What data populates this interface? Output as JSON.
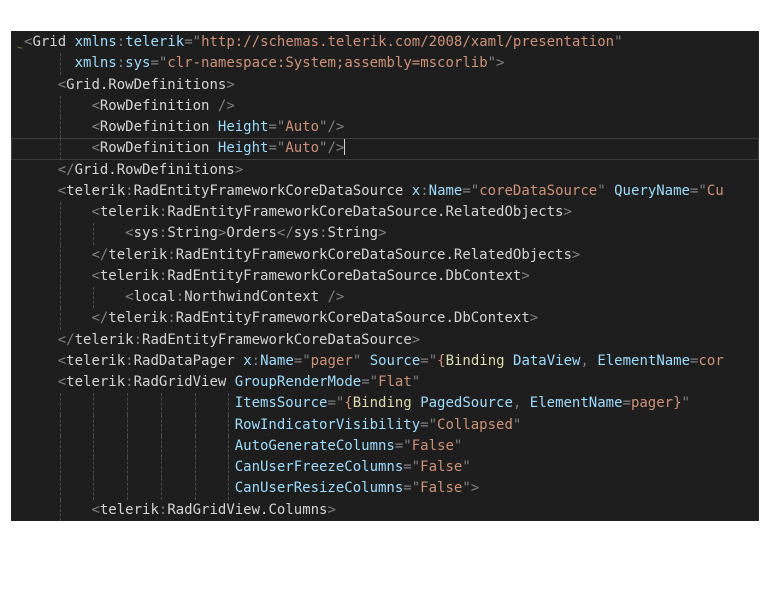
{
  "colors": {
    "background": "#1e1e1e",
    "delimiter": "#808080",
    "element": "#d4d4d4",
    "attribute": "#9cdcfe",
    "string": "#ce9178",
    "markup_extension": "#dcdcaa"
  },
  "editor": {
    "lines": [
      {
        "indent": 0,
        "tokens": [
          [
            "p",
            "<"
          ],
          [
            "t",
            "Grid"
          ],
          [
            "x",
            " "
          ],
          [
            "a",
            "xmlns"
          ],
          [
            "p",
            ":"
          ],
          [
            "a",
            "telerik"
          ],
          [
            "p",
            "=\""
          ],
          [
            "s",
            "http://schemas.telerik.com/2008/xaml/presentation"
          ],
          [
            "p",
            "\""
          ]
        ]
      },
      {
        "indent": 6,
        "tokens": [
          [
            "a",
            "xmlns"
          ],
          [
            "p",
            ":"
          ],
          [
            "a",
            "sys"
          ],
          [
            "p",
            "=\""
          ],
          [
            "s",
            "clr-namespace:System;assembly=mscorlib"
          ],
          [
            "p",
            "\">"
          ]
        ]
      },
      {
        "indent": 4,
        "tokens": [
          [
            "p",
            "<"
          ],
          [
            "t",
            "Grid.RowDefinitions"
          ],
          [
            "p",
            ">"
          ]
        ]
      },
      {
        "indent": 8,
        "tokens": [
          [
            "p",
            "<"
          ],
          [
            "t",
            "RowDefinition"
          ],
          [
            "x",
            " "
          ],
          [
            "p",
            "/>"
          ]
        ]
      },
      {
        "indent": 8,
        "tokens": [
          [
            "p",
            "<"
          ],
          [
            "t",
            "RowDefinition"
          ],
          [
            "x",
            " "
          ],
          [
            "a",
            "Height"
          ],
          [
            "p",
            "=\""
          ],
          [
            "s",
            "Auto"
          ],
          [
            "p",
            "\"/>"
          ]
        ]
      },
      {
        "indent": 8,
        "current": true,
        "tokens": [
          [
            "p",
            "<"
          ],
          [
            "t",
            "RowDefinition"
          ],
          [
            "x",
            " "
          ],
          [
            "a",
            "Height"
          ],
          [
            "p",
            "=\""
          ],
          [
            "s",
            "Auto"
          ],
          [
            "p",
            "\"/>"
          ]
        ]
      },
      {
        "indent": 4,
        "tokens": [
          [
            "p",
            "</"
          ],
          [
            "t",
            "Grid.RowDefinitions"
          ],
          [
            "p",
            ">"
          ]
        ]
      },
      {
        "indent": 4,
        "tokens": [
          [
            "p",
            "<"
          ],
          [
            "t",
            "telerik"
          ],
          [
            "p",
            ":"
          ],
          [
            "t",
            "RadEntityFrameworkCoreDataSource"
          ],
          [
            "x",
            " "
          ],
          [
            "a",
            "x"
          ],
          [
            "p",
            ":"
          ],
          [
            "a",
            "Name"
          ],
          [
            "p",
            "=\""
          ],
          [
            "s",
            "coreDataSource"
          ],
          [
            "p",
            "\""
          ],
          [
            "x",
            " "
          ],
          [
            "a",
            "QueryName"
          ],
          [
            "p",
            "=\""
          ],
          [
            "s",
            "Cu"
          ]
        ]
      },
      {
        "indent": 8,
        "tokens": [
          [
            "p",
            "<"
          ],
          [
            "t",
            "telerik"
          ],
          [
            "p",
            ":"
          ],
          [
            "t",
            "RadEntityFrameworkCoreDataSource.RelatedObjects"
          ],
          [
            "p",
            ">"
          ]
        ]
      },
      {
        "indent": 12,
        "tokens": [
          [
            "p",
            "<"
          ],
          [
            "t",
            "sys"
          ],
          [
            "p",
            ":"
          ],
          [
            "t",
            "String"
          ],
          [
            "p",
            ">"
          ],
          [
            "x",
            "Orders"
          ],
          [
            "p",
            "</"
          ],
          [
            "t",
            "sys"
          ],
          [
            "p",
            ":"
          ],
          [
            "t",
            "String"
          ],
          [
            "p",
            ">"
          ]
        ]
      },
      {
        "indent": 8,
        "tokens": [
          [
            "p",
            "</"
          ],
          [
            "t",
            "telerik"
          ],
          [
            "p",
            ":"
          ],
          [
            "t",
            "RadEntityFrameworkCoreDataSource.RelatedObjects"
          ],
          [
            "p",
            ">"
          ]
        ]
      },
      {
        "indent": 8,
        "tokens": [
          [
            "p",
            "<"
          ],
          [
            "t",
            "telerik"
          ],
          [
            "p",
            ":"
          ],
          [
            "t",
            "RadEntityFrameworkCoreDataSource.DbContext"
          ],
          [
            "p",
            ">"
          ]
        ]
      },
      {
        "indent": 12,
        "tokens": [
          [
            "p",
            "<"
          ],
          [
            "t",
            "local"
          ],
          [
            "p",
            ":"
          ],
          [
            "t",
            "NorthwindContext"
          ],
          [
            "x",
            " "
          ],
          [
            "p",
            "/>"
          ]
        ]
      },
      {
        "indent": 8,
        "tokens": [
          [
            "p",
            "</"
          ],
          [
            "t",
            "telerik"
          ],
          [
            "p",
            ":"
          ],
          [
            "t",
            "RadEntityFrameworkCoreDataSource.DbContext"
          ],
          [
            "p",
            ">"
          ]
        ]
      },
      {
        "indent": 4,
        "tokens": [
          [
            "p",
            "</"
          ],
          [
            "t",
            "telerik"
          ],
          [
            "p",
            ":"
          ],
          [
            "t",
            "RadEntityFrameworkCoreDataSource"
          ],
          [
            "p",
            ">"
          ]
        ]
      },
      {
        "indent": 4,
        "tokens": [
          [
            "p",
            "<"
          ],
          [
            "t",
            "telerik"
          ],
          [
            "p",
            ":"
          ],
          [
            "t",
            "RadDataPager"
          ],
          [
            "x",
            " "
          ],
          [
            "a",
            "x"
          ],
          [
            "p",
            ":"
          ],
          [
            "a",
            "Name"
          ],
          [
            "p",
            "=\""
          ],
          [
            "s",
            "pager"
          ],
          [
            "p",
            "\""
          ],
          [
            "x",
            " "
          ],
          [
            "a",
            "Source"
          ],
          [
            "p",
            "=\""
          ],
          [
            "s",
            "{"
          ],
          [
            "m",
            "Binding"
          ],
          [
            "x",
            " "
          ],
          [
            "a",
            "DataView"
          ],
          [
            "p",
            ","
          ],
          [
            "x",
            " "
          ],
          [
            "a",
            "ElementName"
          ],
          [
            "p",
            "="
          ],
          [
            "s",
            "cor"
          ]
        ]
      },
      {
        "indent": 4,
        "tokens": [
          [
            "p",
            "<"
          ],
          [
            "t",
            "telerik"
          ],
          [
            "p",
            ":"
          ],
          [
            "t",
            "RadGridView"
          ],
          [
            "x",
            " "
          ],
          [
            "a",
            "GroupRenderMode"
          ],
          [
            "p",
            "=\""
          ],
          [
            "s",
            "Flat"
          ],
          [
            "p",
            "\""
          ]
        ]
      },
      {
        "indent": 25,
        "tokens": [
          [
            "a",
            "ItemsSource"
          ],
          [
            "p",
            "=\""
          ],
          [
            "s",
            "{"
          ],
          [
            "m",
            "Binding"
          ],
          [
            "x",
            " "
          ],
          [
            "a",
            "PagedSource"
          ],
          [
            "p",
            ","
          ],
          [
            "x",
            " "
          ],
          [
            "a",
            "ElementName"
          ],
          [
            "p",
            "="
          ],
          [
            "s",
            "pager"
          ],
          [
            "s",
            "}"
          ],
          [
            "p",
            "\""
          ]
        ]
      },
      {
        "indent": 25,
        "tokens": [
          [
            "a",
            "RowIndicatorVisibility"
          ],
          [
            "p",
            "=\""
          ],
          [
            "s",
            "Collapsed"
          ],
          [
            "p",
            "\""
          ]
        ]
      },
      {
        "indent": 25,
        "tokens": [
          [
            "a",
            "AutoGenerateColumns"
          ],
          [
            "p",
            "=\""
          ],
          [
            "s",
            "False"
          ],
          [
            "p",
            "\""
          ]
        ]
      },
      {
        "indent": 25,
        "tokens": [
          [
            "a",
            "CanUserFreezeColumns"
          ],
          [
            "p",
            "=\""
          ],
          [
            "s",
            "False"
          ],
          [
            "p",
            "\""
          ]
        ]
      },
      {
        "indent": 25,
        "tokens": [
          [
            "a",
            "CanUserResizeColumns"
          ],
          [
            "p",
            "=\""
          ],
          [
            "s",
            "False"
          ],
          [
            "p",
            "\">"
          ]
        ]
      },
      {
        "indent": 8,
        "tokens": [
          [
            "p",
            "<"
          ],
          [
            "t",
            "telerik"
          ],
          [
            "p",
            ":"
          ],
          [
            "t",
            "RadGridView.Columns"
          ],
          [
            "p",
            ">"
          ]
        ]
      }
    ]
  }
}
